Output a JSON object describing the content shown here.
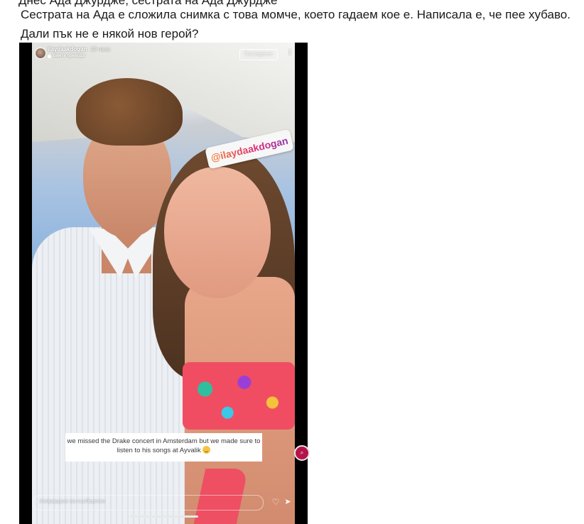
{
  "post": {
    "cut_text": "Днес Ада Джурдже, сестрата на Ада Джурдже",
    "line1": "Сестрата на Ада е сложила снимка с това момче, което гадаем кое е. Написала е, че пее хубаво.",
    "line2": "Дали пък не е някой нов герой?"
  },
  "story": {
    "username": "ilaydaakdogan",
    "time_ago": "19 часа",
    "translation_link": "Вижте превода",
    "follow_label": "Последване",
    "more_icon": "more-icon",
    "mention_text": "@ilaydaakdogan",
    "caption_text": "we missed the Drake concert in Amsterdam but we made sure to listen to his songs at Ayvalik",
    "reply_placeholder": "Изпращане на съобщение"
  },
  "icons": [
    "avatar",
    "globe-icon",
    "more-icon",
    "emoji-icon",
    "sticker-icon",
    "heart-icon",
    "send-icon"
  ]
}
